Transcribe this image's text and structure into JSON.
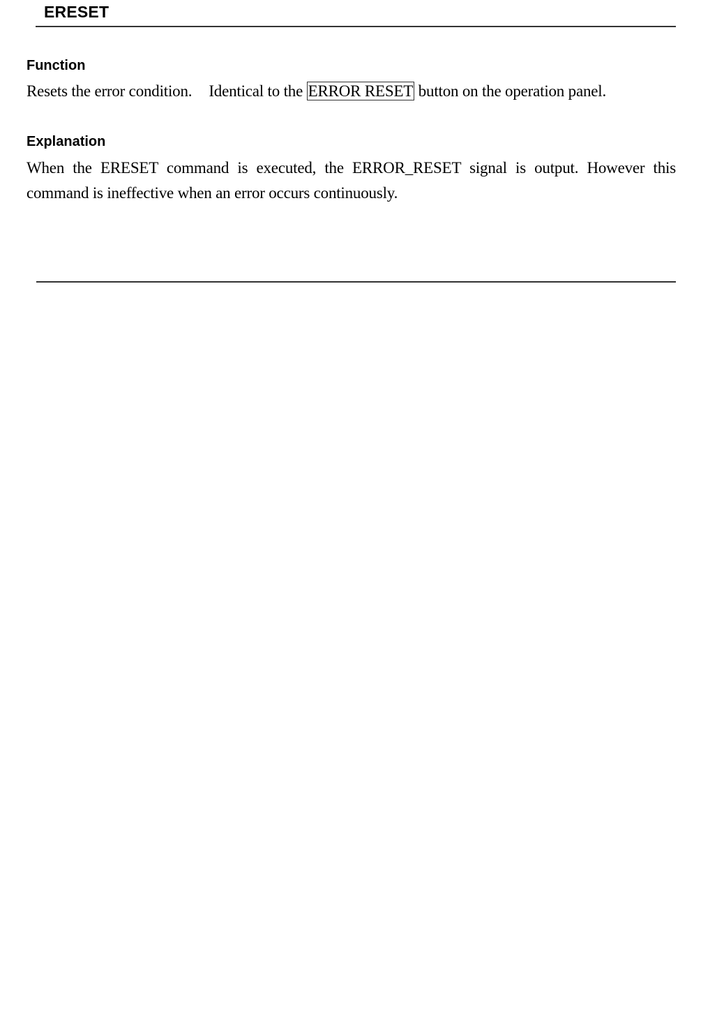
{
  "command": {
    "name": "ERESET"
  },
  "function": {
    "heading": "Function",
    "sentence1": "Resets the error condition.",
    "sentence2_before": "Identical to the",
    "button_label": "ERROR RESET",
    "sentence2_after": "button on the operation panel."
  },
  "explanation": {
    "heading": "Explanation",
    "line1_part1": "When the ERESET command is executed, the ERROR_RESET signal is output.",
    "line1_part2": "However this",
    "line2": "command is ineffective when an error occurs continuously."
  }
}
